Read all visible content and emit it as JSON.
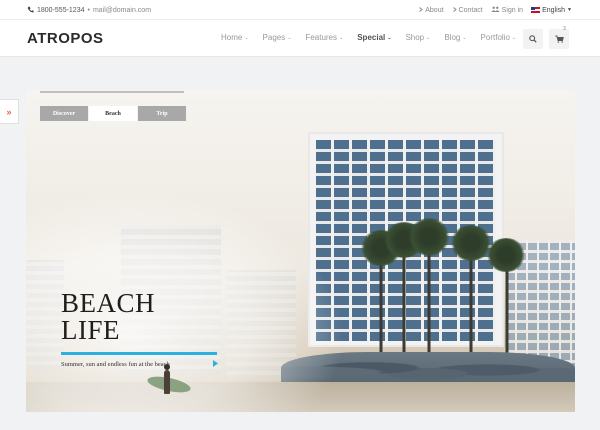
{
  "topbar": {
    "phone": "1800-555-1234",
    "separator": "•",
    "email": "mail@domain.com",
    "links": [
      {
        "label": "About",
        "icon": "info-icon"
      },
      {
        "label": "Contact",
        "icon": "envelope-icon"
      },
      {
        "label": "Sign in",
        "icon": "users-icon"
      }
    ],
    "language": "English"
  },
  "header": {
    "logo": "ATROPOS",
    "nav": [
      {
        "label": "Home",
        "dropdown": true
      },
      {
        "label": "Pages",
        "dropdown": true
      },
      {
        "label": "Features",
        "dropdown": true
      },
      {
        "label": "Special",
        "dropdown": true,
        "active": true
      },
      {
        "label": "Shop",
        "dropdown": true
      },
      {
        "label": "Blog",
        "dropdown": true
      },
      {
        "label": "Portfolio",
        "dropdown": true
      }
    ],
    "cart_count": "3"
  },
  "side_toggle": {
    "glyph": "»"
  },
  "hero": {
    "tabs": [
      {
        "label": "Discover",
        "active": false
      },
      {
        "label": "Beach",
        "active": true
      },
      {
        "label": "Trip",
        "active": false
      }
    ],
    "title_line1": "BEACH",
    "title_line2": "LIFE",
    "subtitle": "Summer, sun and endless fun at the beach",
    "accent_color": "#2bb0e0"
  },
  "colors": {
    "accent": "#2bb0e0",
    "toggle": "#e6643c"
  }
}
